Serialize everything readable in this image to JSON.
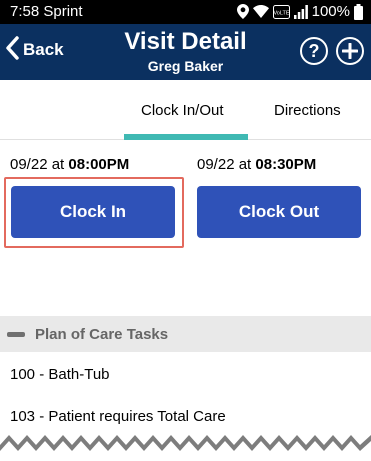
{
  "status_bar": {
    "time_carrier": "7:58 Sprint",
    "battery": "100%",
    "icons": [
      "location-icon",
      "wifi-icon",
      "volte-icon",
      "signal-icon",
      "battery-icon"
    ],
    "volte_text": "VoLTE"
  },
  "header": {
    "back_label": "Back",
    "title": "Visit Detail",
    "subtitle": "Greg Baker",
    "help_symbol": "?",
    "icons": [
      "chevron-left-icon",
      "help-icon",
      "add-icon"
    ]
  },
  "tabs": [
    {
      "label": "Clock In/Out",
      "active": true
    },
    {
      "label": "Directions",
      "active": false
    }
  ],
  "clock": {
    "in": {
      "date": "09/22",
      "at": "at",
      "time": "08:00PM",
      "button_label": "Clock In",
      "highlighted": true
    },
    "out": {
      "date": "09/22",
      "at": "at",
      "time": "08:30PM",
      "button_label": "Clock Out"
    }
  },
  "plan_of_care": {
    "title": "Plan of Care Tasks",
    "tasks": [
      "100 - Bath-Tub",
      "103 - Patient requires Total Care"
    ]
  },
  "colors": {
    "header_bg": "#0b3060",
    "button_bg": "#2f52b8",
    "tab_indicator": "#3fb9b3",
    "highlight_border": "#e36a5e",
    "section_bg": "#e9e9e9"
  }
}
